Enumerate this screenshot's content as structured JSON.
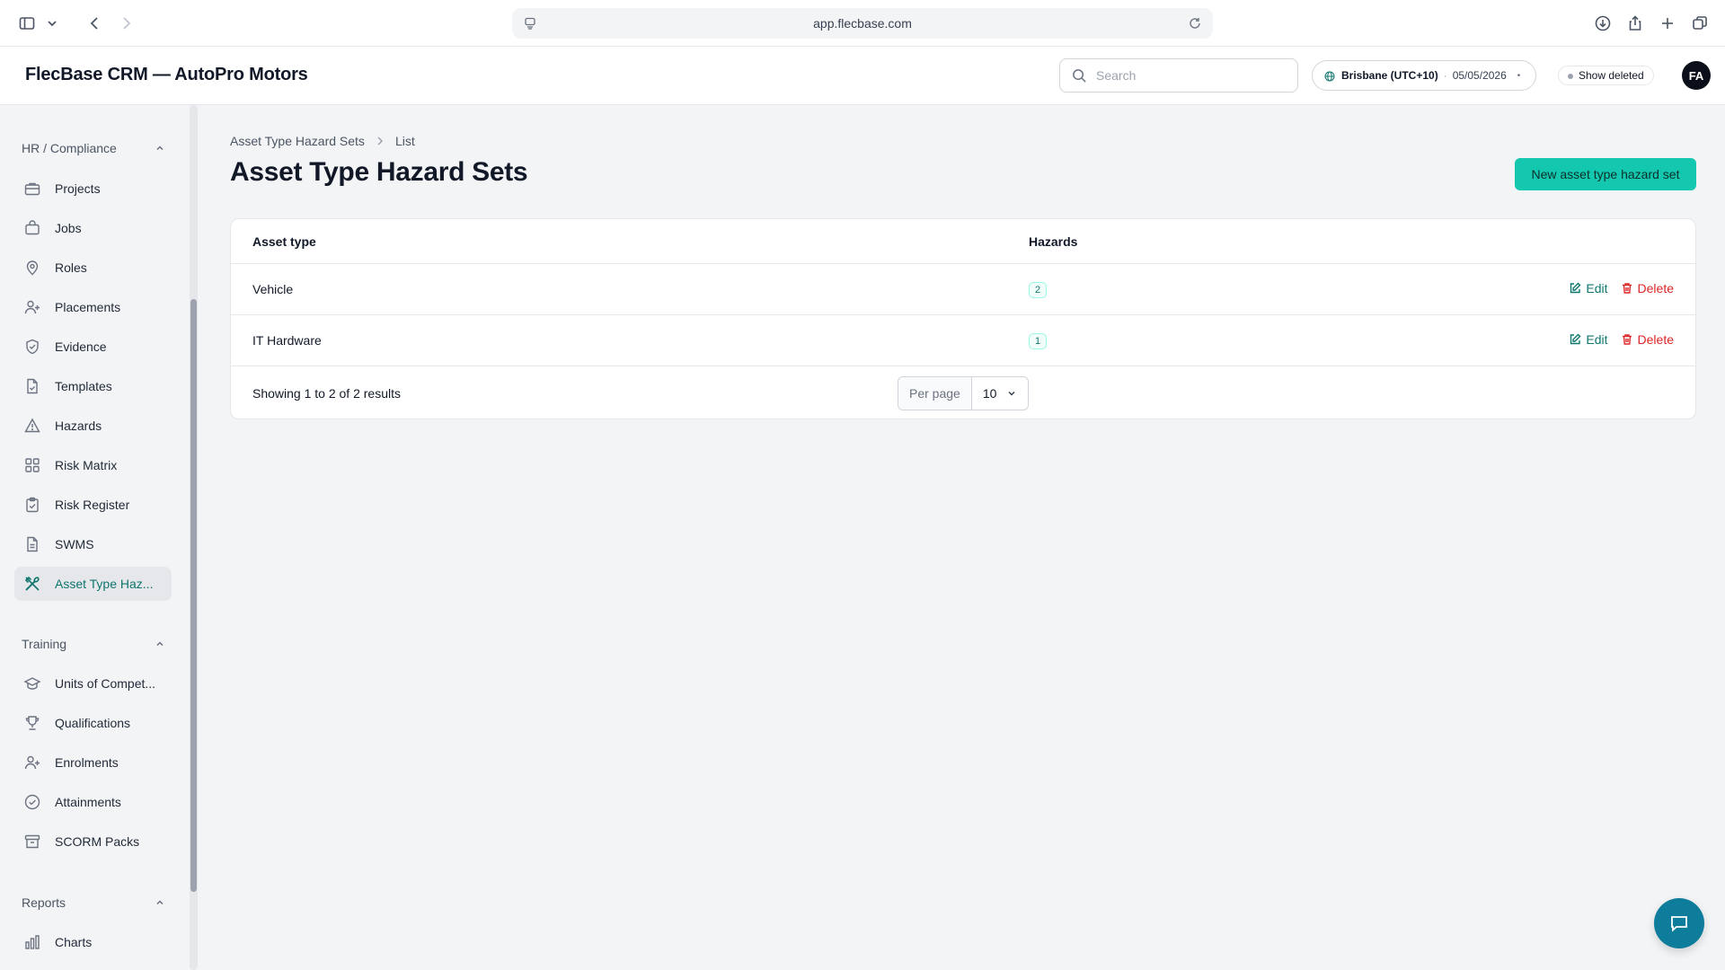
{
  "browser": {
    "url": "app.flecbase.com"
  },
  "header": {
    "app_title": "FlecBase CRM — AutoPro Motors",
    "search_placeholder": "Search",
    "timezone": "Brisbane (UTC+10)",
    "date": "05/05/2026",
    "show_deleted_label": "Show deleted",
    "avatar_initials": "FA"
  },
  "sidebar": {
    "groups": [
      {
        "title": "HR / Compliance",
        "items": [
          {
            "label": "Projects",
            "icon": "briefcase-icon"
          },
          {
            "label": "Jobs",
            "icon": "bag-icon"
          },
          {
            "label": "Roles",
            "icon": "map-pin-icon"
          },
          {
            "label": "Placements",
            "icon": "user-plus-icon"
          },
          {
            "label": "Evidence",
            "icon": "shield-check-icon"
          },
          {
            "label": "Templates",
            "icon": "document-check-icon"
          },
          {
            "label": "Hazards",
            "icon": "warning-triangle-icon"
          },
          {
            "label": "Risk Matrix",
            "icon": "grid-icon"
          },
          {
            "label": "Risk Register",
            "icon": "clipboard-check-icon"
          },
          {
            "label": "SWMS",
            "icon": "document-icon"
          },
          {
            "label": "Asset Type Haz...",
            "icon": "wrench-screwdriver-icon",
            "active": true
          }
        ]
      },
      {
        "title": "Training",
        "items": [
          {
            "label": "Units of Compet...",
            "icon": "graduation-cap-icon"
          },
          {
            "label": "Qualifications",
            "icon": "trophy-icon"
          },
          {
            "label": "Enrolments",
            "icon": "user-plus-icon"
          },
          {
            "label": "Attainments",
            "icon": "check-circle-icon"
          },
          {
            "label": "SCORM Packs",
            "icon": "archive-box-icon"
          }
        ]
      },
      {
        "title": "Reports",
        "items": [
          {
            "label": "Charts",
            "icon": "bar-chart-icon"
          }
        ]
      }
    ]
  },
  "main": {
    "breadcrumb": [
      "Asset Type Hazard Sets",
      "List"
    ],
    "title": "Asset Type Hazard Sets",
    "new_button_label": "New asset type hazard set",
    "table": {
      "columns": [
        "Asset type",
        "Hazards"
      ],
      "rows": [
        {
          "asset_type": "Vehicle",
          "hazards": "2"
        },
        {
          "asset_type": "IT Hardware",
          "hazards": "1"
        }
      ],
      "edit_label": "Edit",
      "delete_label": "Delete"
    },
    "footer": {
      "results_text": "Showing 1 to 2 of 2 results",
      "per_page_label": "Per page",
      "per_page_value": "10"
    }
  },
  "colors": {
    "accent": "#14c8b0",
    "accent_text": "#0f766e",
    "danger": "#dc2626",
    "chat_fab": "#0e7c9b"
  }
}
